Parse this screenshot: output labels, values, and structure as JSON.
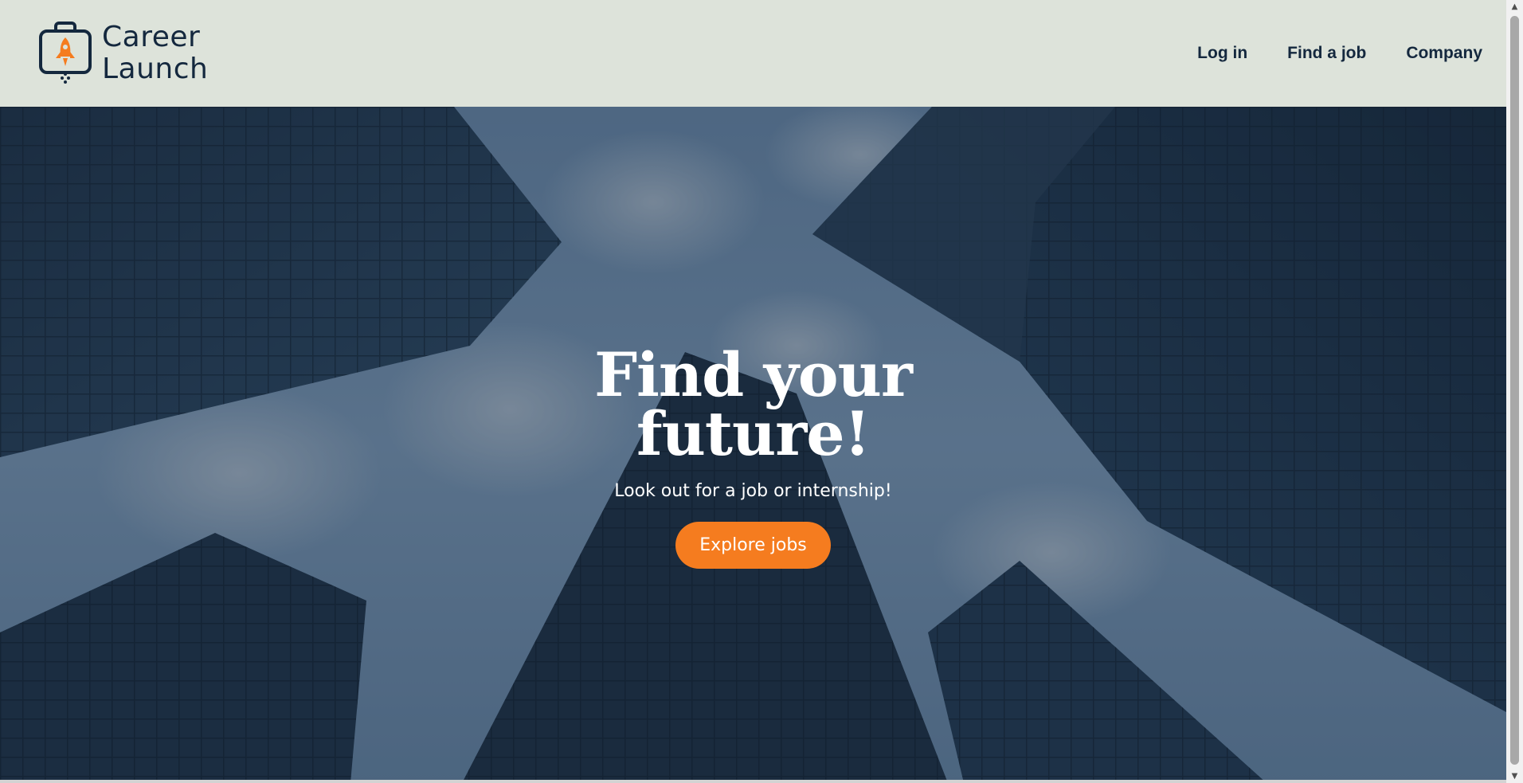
{
  "brand": {
    "name_line1": "Career",
    "name_line2": "Launch",
    "icon": "briefcase-rocket-icon",
    "colors": {
      "navy": "#14283e",
      "orange": "#f57c1f"
    }
  },
  "nav": {
    "items": [
      {
        "label": "Log in"
      },
      {
        "label": "Find a job"
      },
      {
        "label": "Company"
      }
    ]
  },
  "hero": {
    "title_line1": "Find your",
    "title_line2": "future!",
    "subtitle": "Look out for a job or internship!",
    "cta_label": "Explore jobs",
    "background": "skyscrapers-photo"
  },
  "colors": {
    "header_bg": "#dde3da",
    "cta_bg": "#f57c1f",
    "text_light": "#ffffff"
  }
}
